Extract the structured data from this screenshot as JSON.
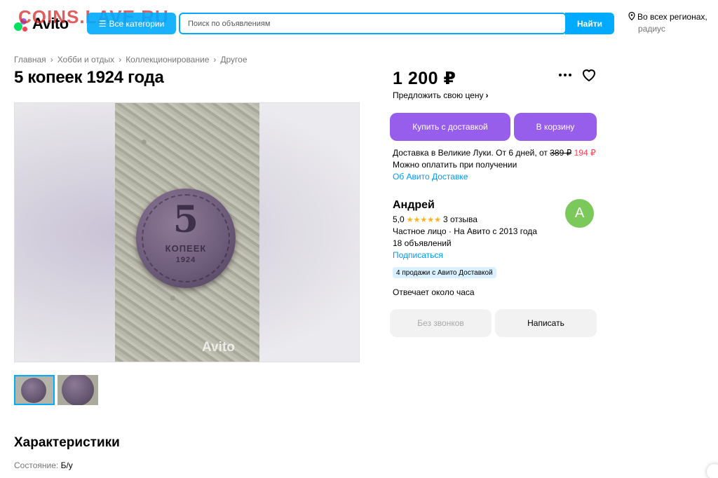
{
  "watermark": "COINS.LAVE.RU",
  "header": {
    "logo_text": "Avito",
    "categories_label": "Все категории",
    "search_placeholder": "Поиск по объявлениям",
    "search_button": "Найти",
    "region_line1": "Во всех регионах,",
    "region_line2": "радиус"
  },
  "breadcrumb": [
    "Главная",
    "Хобби и отдых",
    "Коллекционирование",
    "Другое"
  ],
  "title": "5 копеек 1924 года",
  "gallery": {
    "coin_number": "5",
    "coin_word": "КОПЕЕК",
    "coin_year": "1924",
    "photo_watermark": "Avito"
  },
  "characteristics": {
    "heading": "Характеристики",
    "condition_label": "Состояние:",
    "condition_value": "Б/у"
  },
  "price": {
    "value": "1 200 ₽",
    "offer_label": "Предложить свою цену"
  },
  "buttons": {
    "buy_delivery": "Купить с доставкой",
    "to_cart": "В корзину",
    "no_calls": "Без звонков",
    "write": "Написать"
  },
  "delivery": {
    "prefix": "Доставка в Великие Луки. От 6 дней, от",
    "old_price": "389 ₽",
    "new_price": "194 ₽",
    "payment": "Можно оплатить при получении",
    "link": "Об Авито Доставке"
  },
  "seller": {
    "name": "Андрей",
    "rating": "5,0",
    "stars": "★★★★★",
    "reviews": "3 отзыва",
    "type": "Частное лицо · На Авито с 2013 года",
    "ads": "18 объявлений",
    "subscribe": "Подписаться",
    "badge": "4 продажи с Авито Доставкой",
    "reply_time": "Отвечает около часа",
    "avatar_letter": "А",
    "avatar_color": "#7cc95b"
  },
  "colors": {
    "accent_blue": "#00aaff",
    "accent_purple": "#965eeb",
    "link_blue": "#0099f7",
    "discount_red": "#ff4053"
  }
}
